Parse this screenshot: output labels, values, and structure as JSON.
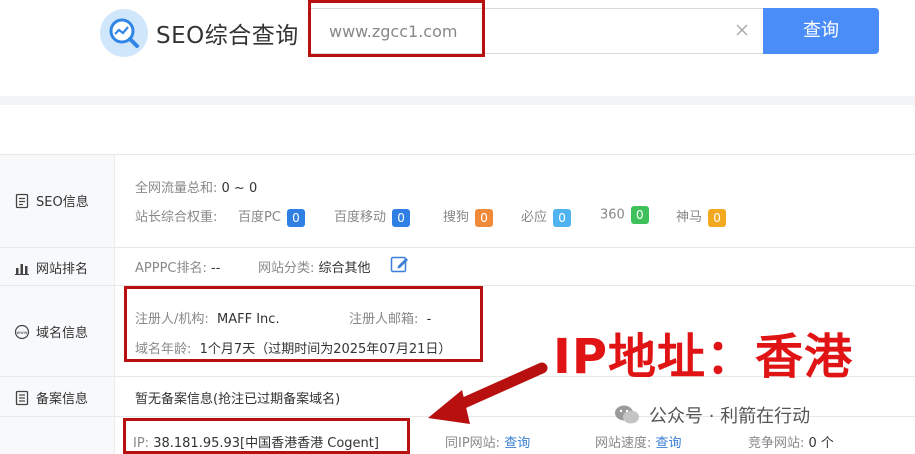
{
  "header": {
    "brand": "SEO综合查询",
    "search_value": "www.zgcc1.com",
    "search_button": "查询"
  },
  "rows": {
    "seo": {
      "label": "SEO信息",
      "traffic_label": "全网流量总和:",
      "traffic_value": "0 ~ 0",
      "weight_label": "站长综合权重:",
      "engines": [
        {
          "name": "百度PC",
          "value": "0",
          "color": "#2f7fe5"
        },
        {
          "name": "百度移动",
          "value": "0",
          "color": "#2f7fe5"
        },
        {
          "name": "搜狗",
          "value": "0",
          "color": "#f08a3b"
        },
        {
          "name": "必应",
          "value": "0",
          "color": "#4fb3f0"
        },
        {
          "name": "360",
          "value": "0",
          "color": "#3ec05a"
        },
        {
          "name": "神马",
          "value": "0",
          "color": "#f2a91f"
        }
      ]
    },
    "rank": {
      "label": "网站排名",
      "apppc_label": "APPPC排名:",
      "apppc_value": "--",
      "category_label": "网站分类:",
      "category_value": "综合其他"
    },
    "domain": {
      "label": "域名信息",
      "registrant_label": "注册人/机构:",
      "registrant_value": "MAFF Inc.",
      "email_label": "注册人邮箱:",
      "email_value": "-",
      "age_label": "域名年龄:",
      "age_value": "1个月7天（过期时间为2025年07月21日）"
    },
    "icp": {
      "label": "备案信息",
      "value": "暂无备案信息(抢注已过期备案域名)"
    },
    "ip": {
      "ip_label": "IP:",
      "ip_value": "38.181.95.93[中国香港香港 Cogent]",
      "same_ip_label": "同IP网站:",
      "same_ip_link": "查询",
      "speed_label": "网站速度:",
      "speed_link": "查询",
      "competitor_label": "竞争网站:",
      "competitor_value": "0 个"
    }
  },
  "annotation": {
    "text": "IP地址：香港",
    "color": "#e01414"
  },
  "watermark": {
    "text": "公众号 · 利箭在行动"
  }
}
